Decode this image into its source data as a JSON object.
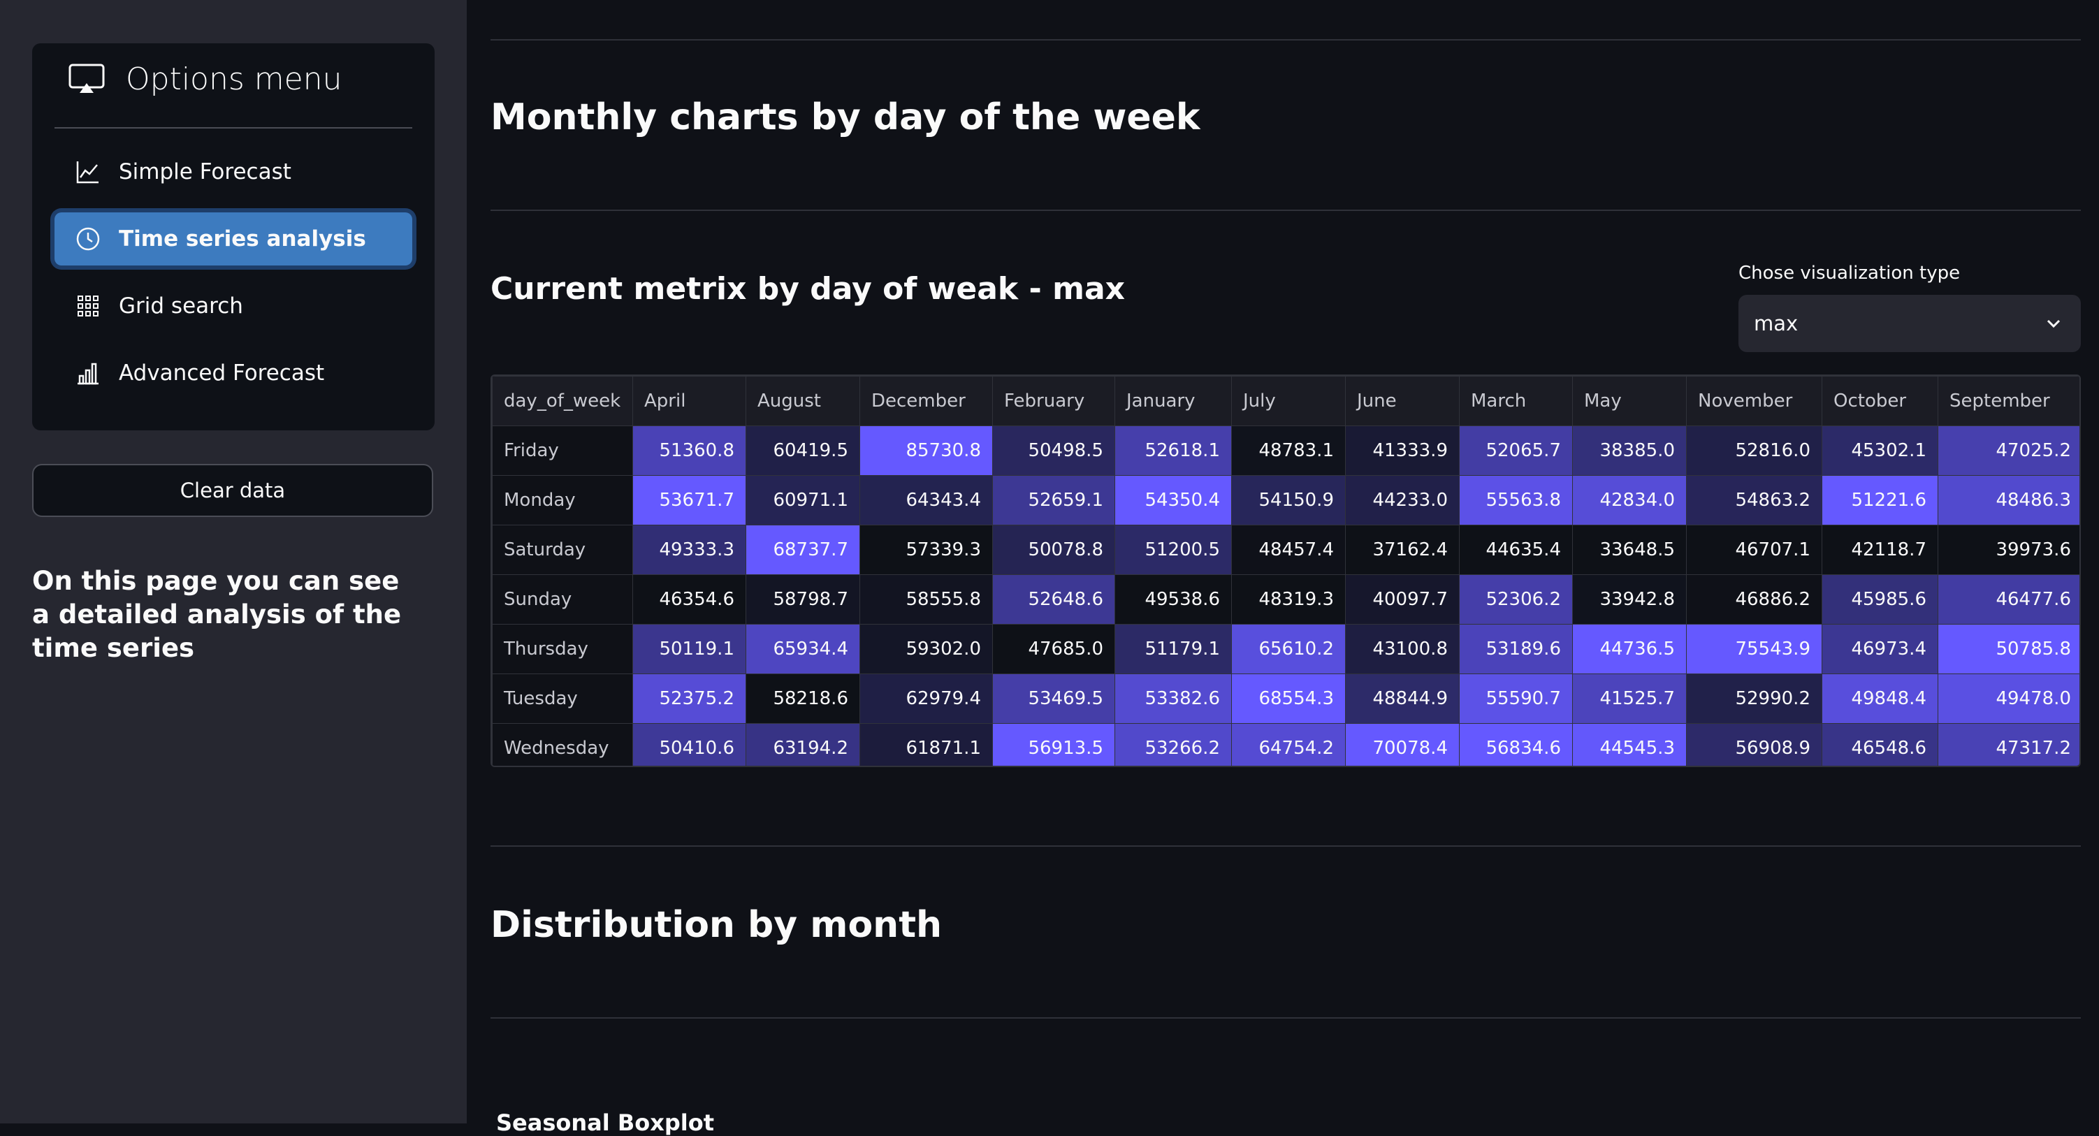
{
  "sidebar": {
    "menu_title": "Options menu",
    "items": [
      {
        "label": "Simple Forecast",
        "icon": "line-chart-icon",
        "active": false
      },
      {
        "label": "Time series analysis",
        "icon": "clock-icon",
        "active": true
      },
      {
        "label": "Grid search",
        "icon": "grid-icon",
        "active": false
      },
      {
        "label": "Advanced Forecast",
        "icon": "bar-chart-icon",
        "active": false
      }
    ],
    "clear_button": "Clear data",
    "description": "On this page you can see a detailed analysis of the time series"
  },
  "main": {
    "monthly_title": "Monthly charts by day of the week",
    "metrix_title": "Current metrix by day of weak - max",
    "select": {
      "label": "Chose visualization type",
      "value": "max"
    },
    "distribution_title": "Distribution by month",
    "seasonal_title": "Seasonal Boxplot"
  },
  "table": {
    "columns": [
      "day_of_week",
      "April",
      "August",
      "December",
      "February",
      "January",
      "July",
      "June",
      "March",
      "May",
      "November",
      "October",
      "September"
    ],
    "rows": [
      {
        "day": "Friday",
        "values": [
          "51360.8",
          "60419.5",
          "85730.8",
          "50498.5",
          "52618.1",
          "48783.1",
          "41333.9",
          "52065.7",
          "38385.0",
          "52816.0",
          "45302.1",
          "47025.2"
        ]
      },
      {
        "day": "Monday",
        "values": [
          "53671.7",
          "60971.1",
          "64343.4",
          "52659.1",
          "54350.4",
          "54150.9",
          "44233.0",
          "55563.8",
          "42834.0",
          "54863.2",
          "51221.6",
          "48486.3"
        ]
      },
      {
        "day": "Saturday",
        "values": [
          "49333.3",
          "68737.7",
          "57339.3",
          "50078.8",
          "51200.5",
          "48457.4",
          "37162.4",
          "44635.4",
          "33648.5",
          "46707.1",
          "42118.7",
          "39973.6"
        ]
      },
      {
        "day": "Sunday",
        "values": [
          "46354.6",
          "58798.7",
          "58555.8",
          "52648.6",
          "49538.6",
          "48319.3",
          "40097.7",
          "52306.2",
          "33942.8",
          "46886.2",
          "45985.6",
          "46477.6"
        ]
      },
      {
        "day": "Thursday",
        "values": [
          "50119.1",
          "65934.4",
          "59302.0",
          "47685.0",
          "51179.1",
          "65610.2",
          "43100.8",
          "53189.6",
          "44736.5",
          "75543.9",
          "46973.4",
          "50785.8"
        ]
      },
      {
        "day": "Tuesday",
        "values": [
          "52375.2",
          "58218.6",
          "62979.4",
          "53469.5",
          "53382.6",
          "68554.3",
          "48844.9",
          "55590.7",
          "41525.7",
          "52990.2",
          "49848.4",
          "49478.0"
        ]
      },
      {
        "day": "Wednesday",
        "values": [
          "50410.6",
          "63194.2",
          "61871.1",
          "56913.5",
          "53266.2",
          "64754.2",
          "70078.4",
          "56834.6",
          "44545.3",
          "56908.9",
          "46548.6",
          "47317.2"
        ]
      }
    ]
  },
  "colors": {
    "sidebar_bg": "#262730",
    "main_bg": "#0f1117",
    "active_item": "#3d7bbf",
    "highlight": "#6559ff"
  }
}
